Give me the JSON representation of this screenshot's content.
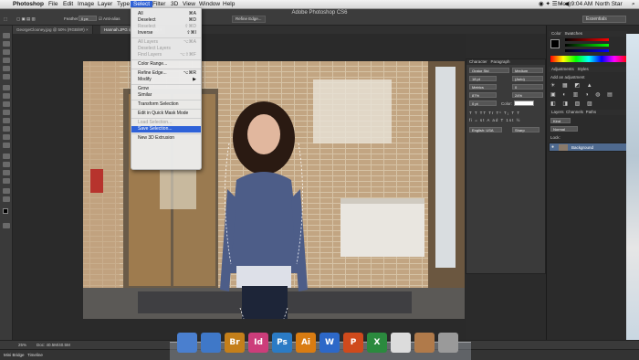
{
  "menubar": {
    "app_name": "Photoshop",
    "items": [
      "File",
      "Edit",
      "Image",
      "Layer",
      "Type",
      "Select",
      "Filter",
      "3D",
      "View",
      "Window",
      "Help"
    ],
    "active_item": "Select",
    "clock": "Mon 9:04 AM",
    "user": "North Star"
  },
  "app_title": "Adobe Photoshop CS6",
  "workspace": "Essentials",
  "options_bar": {
    "feather_label": "Feather:",
    "feather_value": "0 px",
    "anti_alias": "Anti-alias",
    "refine_edge": "Refine Edge..."
  },
  "tabs": [
    {
      "label": "GeorgeClooney.jpg @ 50% (RGB/8#) ×",
      "active": false
    },
    {
      "label": "Hannah.JPG @ 25% (RGB/8) ×",
      "active": true
    }
  ],
  "select_menu": [
    {
      "label": "All",
      "shortcut": "⌘A",
      "disabled": false
    },
    {
      "label": "Deselect",
      "shortcut": "⌘D",
      "disabled": false
    },
    {
      "label": "Reselect",
      "shortcut": "⇧⌘D",
      "disabled": true
    },
    {
      "label": "Inverse",
      "shortcut": "⇧⌘I",
      "disabled": false
    },
    {
      "sep": true
    },
    {
      "label": "All Layers",
      "shortcut": "⌥⌘A",
      "disabled": true
    },
    {
      "label": "Deselect Layers",
      "shortcut": "",
      "disabled": true
    },
    {
      "label": "Find Layers",
      "shortcut": "⌥⇧⌘F",
      "disabled": true
    },
    {
      "sep": true
    },
    {
      "label": "Color Range...",
      "shortcut": "",
      "disabled": false
    },
    {
      "sep": true
    },
    {
      "label": "Refine Edge...",
      "shortcut": "⌥⌘R",
      "disabled": false
    },
    {
      "label": "Modify",
      "shortcut": "▶",
      "disabled": false
    },
    {
      "sep": true
    },
    {
      "label": "Grow",
      "shortcut": "",
      "disabled": false
    },
    {
      "label": "Similar",
      "shortcut": "",
      "disabled": false
    },
    {
      "sep": true
    },
    {
      "label": "Transform Selection",
      "shortcut": "",
      "disabled": false
    },
    {
      "sep": true
    },
    {
      "label": "Edit in Quick Mask Mode",
      "shortcut": "",
      "disabled": false
    },
    {
      "sep": true
    },
    {
      "label": "Load Selection...",
      "shortcut": "",
      "disabled": true
    },
    {
      "label": "Save Selection...",
      "shortcut": "",
      "disabled": false,
      "highlight": true
    },
    {
      "sep": true
    },
    {
      "label": "New 3D Extrusion",
      "shortcut": "",
      "disabled": false
    }
  ],
  "character_panel": {
    "tabs": [
      "Character",
      "Paragraph"
    ],
    "font": "Orator Std",
    "style": "Medium",
    "size": "18 pt",
    "leading": "(Auto)",
    "kerning": "Metrics",
    "tracking": "0",
    "vscale": "87%",
    "hscale": "24%",
    "baseline": "0 pt",
    "color_label": "Color:",
    "language": "English: USA",
    "aa": "Sharp"
  },
  "right_panels": {
    "color_tabs": [
      "Color",
      "Swatches"
    ],
    "adjustments_tabs": [
      "Adjustments",
      "Styles"
    ],
    "add_adjustment": "Add an adjustment",
    "layers_tabs": [
      "Layers",
      "Channels",
      "Paths"
    ],
    "kind": "Kind",
    "blend": "Normal",
    "lock_label": "Lock:",
    "layer_name": "Background"
  },
  "status": {
    "zoom": "25%",
    "doc": "Doc: 40.5M/40.5M"
  },
  "minibridge": {
    "tabs": [
      "Mini Bridge",
      "Timeline"
    ]
  },
  "dock_icons": [
    {
      "label": "",
      "color": "#4a7fcf"
    },
    {
      "label": "",
      "color": "#3f78c8"
    },
    {
      "label": "Br",
      "color": "#c47f1a"
    },
    {
      "label": "Id",
      "color": "#cc3d7a"
    },
    {
      "label": "Ps",
      "color": "#2b7bc5"
    },
    {
      "label": "Ai",
      "color": "#d97c12"
    },
    {
      "label": "W",
      "color": "#2d68c8"
    },
    {
      "label": "P",
      "color": "#cf4a1c"
    },
    {
      "label": "X",
      "color": "#2b8a3e"
    },
    {
      "label": "",
      "color": "#dcdcdc"
    },
    {
      "label": "",
      "color": "#b07a4a"
    },
    {
      "label": "",
      "color": "#9a9a9a"
    }
  ],
  "colors": {
    "highlight": "#2f62d8",
    "panel": "#3a3a3a",
    "dark": "#2b2b2b"
  }
}
